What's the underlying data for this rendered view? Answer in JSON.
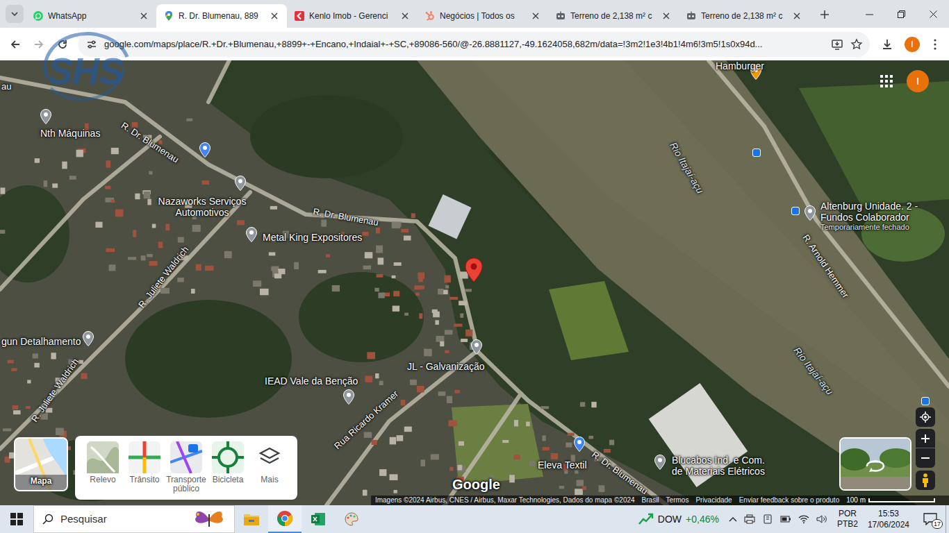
{
  "browser": {
    "tabs": [
      {
        "label": "WhatsApp",
        "kind": "whatsapp",
        "selected": false
      },
      {
        "label": "R. Dr. Blumenau, 889",
        "kind": "maps",
        "selected": true
      },
      {
        "label": "Kenlo Imob - Gerenci",
        "kind": "kenlo",
        "selected": false
      },
      {
        "label": "Negócios | Todos os",
        "kind": "hubspot",
        "selected": false
      },
      {
        "label": "Terreno de 2,138 m² c",
        "kind": "site",
        "selected": false
      },
      {
        "label": "Terreno de 2,138 m² c",
        "kind": "site",
        "selected": false
      }
    ],
    "url": "google.com/maps/place/R.+Dr.+Blumenau,+8899+-+Encano,+Indaial+-+SC,+89086-560/@-26.8881127,-49.1624058,682m/data=!3m2!1e3!4b1!4m6!3m5!1s0x94d...",
    "profile": "I"
  },
  "watermark": "SHS",
  "map": {
    "places": [
      {
        "name": "Nth Máquinas",
        "kind": "default"
      },
      {
        "name": "Nazaworks Serviços Automotivos",
        "kind": "default"
      },
      {
        "name": "Metal King Expositores",
        "kind": "default"
      },
      {
        "name": "gun Detalhamento",
        "kind": "default"
      },
      {
        "name": "IEAD Vale da Benção",
        "kind": "default"
      },
      {
        "name": "JL - Galvanização",
        "kind": "default"
      },
      {
        "name": "Eleva Textil",
        "kind": "shop"
      },
      {
        "name": "Blucabos Ind. e Com. de Materiais Elétricos",
        "kind": "default"
      },
      {
        "name": "Altenburg Unidade. 2 - Fundos Colaborador",
        "kind": "default",
        "note": "Temporariamente fechado"
      },
      {
        "name": "Hamburger",
        "kind": "food"
      }
    ],
    "streets": [
      "au",
      "R. Dr. Blumenau",
      "R. Dr. Blumenau",
      "R. Dr. Blumenau",
      "R. Juliete Waldrich",
      "R. Juliete Waldrich",
      "Rua Ricardo Kramer",
      "R. Arnold Hemmer"
    ],
    "waters": [
      "Rio Itajaí-açu",
      "Rio Itajaí-açu"
    ],
    "profile": "I",
    "layers": {
      "base": "Mapa",
      "options": [
        "Relevo",
        "Trânsito",
        "Transporte público",
        "Bicicleta",
        "Mais"
      ]
    },
    "logo": "Google",
    "attribution": [
      "Imagens ©2024 Airbus, CNES / Airbus, Maxar Technologies, Dados do mapa ©2024",
      "Brasil",
      "Termos",
      "Privacidade",
      "Enviar feedback sobre o produto"
    ],
    "scale": "100 m"
  },
  "taskbar": {
    "search": "Pesquisar",
    "ticker": "DOW",
    "change": "+0,46%",
    "lang": "POR",
    "layout": "PTB2",
    "time": "15:53",
    "date": "17/06/2024",
    "notifications": "17"
  }
}
